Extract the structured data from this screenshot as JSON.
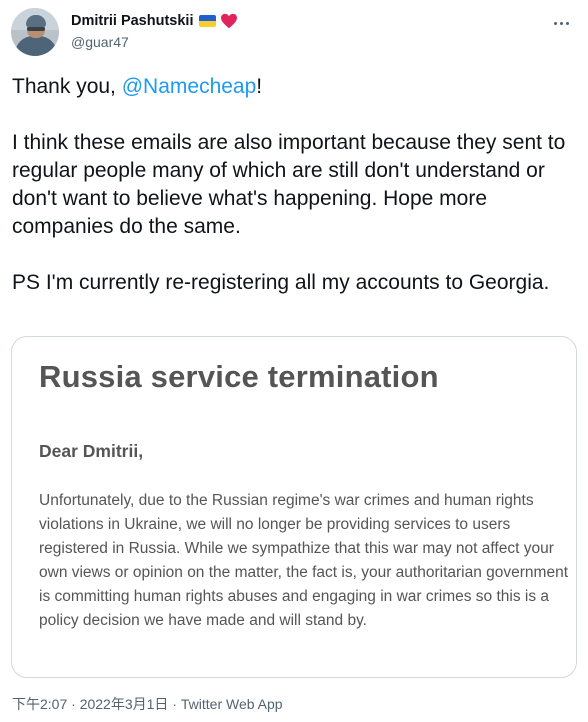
{
  "author": {
    "display_name": "Dmitrii Pashutskii",
    "handle": "@guar47",
    "badges": [
      "ukraine-flag-icon",
      "red-heart-icon"
    ]
  },
  "tweet": {
    "line1_prefix": "Thank you, ",
    "mention": "@Namecheap",
    "line1_suffix": "!",
    "paragraph2": "I think these emails are also important because they sent to regular people many of which are still don't understand or don't want to believe what's happening. Hope more companies do the same.",
    "paragraph3": "PS I'm currently re-registering all my accounts to Georgia."
  },
  "media": {
    "title": "Russia service termination",
    "greeting": "Dear Dmitrii,",
    "body": "Unfortunately, due to the Russian regime's war crimes and human rights violations in Ukraine, we will no longer be providing services to users registered in Russia. While we sympathize that this war may not affect your own views or opinion on the matter, the fact is, your authoritarian government is committing human rights abuses and engaging in war crimes so this is a policy decision we have made and will stand by."
  },
  "meta": {
    "time": "下午2:07",
    "separator1": " · ",
    "date": "2022年3月1日",
    "separator2": " · ",
    "source": "Twitter Web App"
  },
  "colors": {
    "link": "#1d9bf0",
    "text": "#0f1419",
    "secondary": "#536471",
    "flag_blue": "#1f5fd1",
    "flag_yellow": "#f7cf2a",
    "heart": "#e0245e"
  }
}
